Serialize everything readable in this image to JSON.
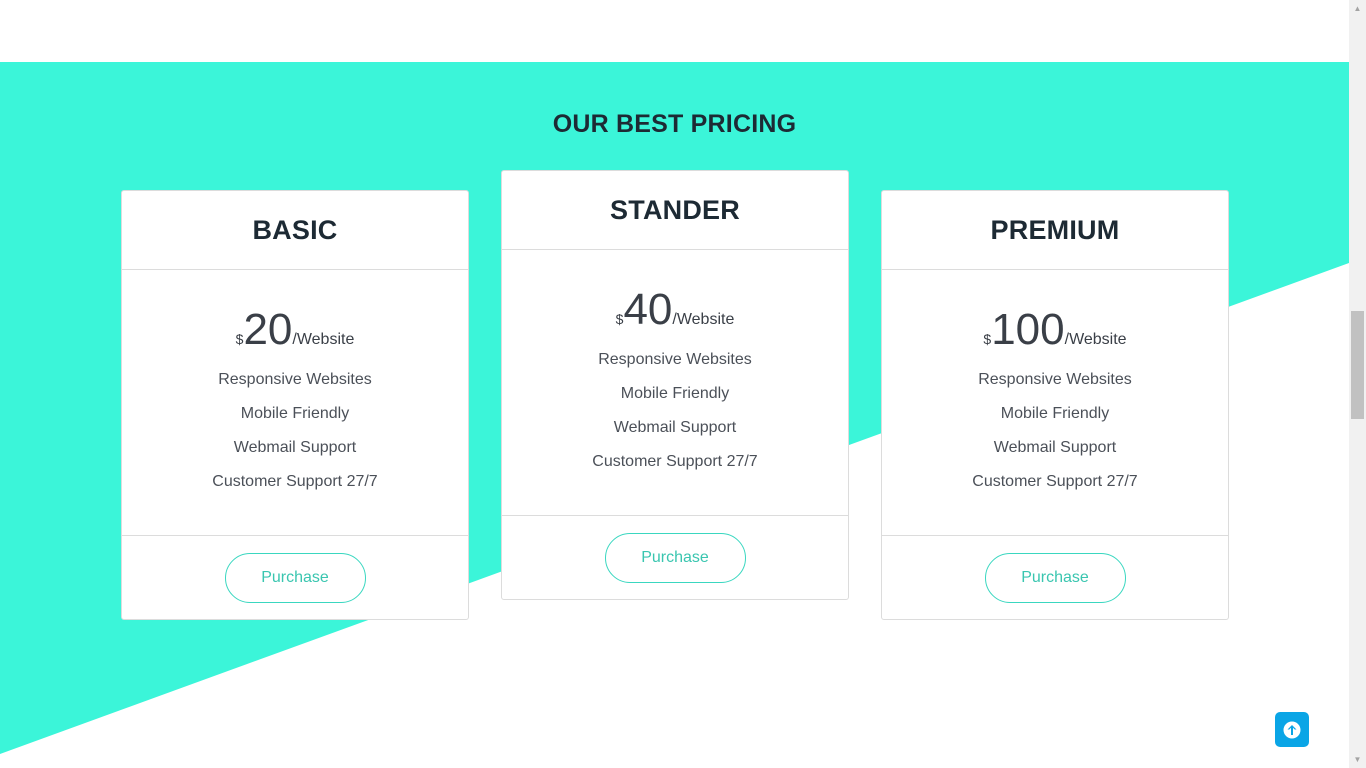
{
  "colors": {
    "accent": "#3BF5D9",
    "button_text": "#3AC6B0",
    "heading": "#1D2A34",
    "back_to_top": "#0AA5E6"
  },
  "section": {
    "title": "OUR BEST PRICING"
  },
  "plans": [
    {
      "name": "BASIC",
      "currency": "$",
      "price": "20",
      "unit": "/Website",
      "features": [
        "Responsive Websites",
        "Mobile Friendly",
        "Webmail Support",
        "Customer Support 27/7"
      ],
      "button_label": "Purchase"
    },
    {
      "name": "STANDER",
      "currency": "$",
      "price": "40",
      "unit": "/Website",
      "features": [
        "Responsive Websites",
        "Mobile Friendly",
        "Webmail Support",
        "Customer Support 27/7"
      ],
      "button_label": "Purchase"
    },
    {
      "name": "PREMIUM",
      "currency": "$",
      "price": "100",
      "unit": "/Website",
      "features": [
        "Responsive Websites",
        "Mobile Friendly",
        "Webmail Support",
        "Customer Support 27/7"
      ],
      "button_label": "Purchase"
    }
  ],
  "icons": {
    "back_to_top": "arrow-up-icon"
  }
}
